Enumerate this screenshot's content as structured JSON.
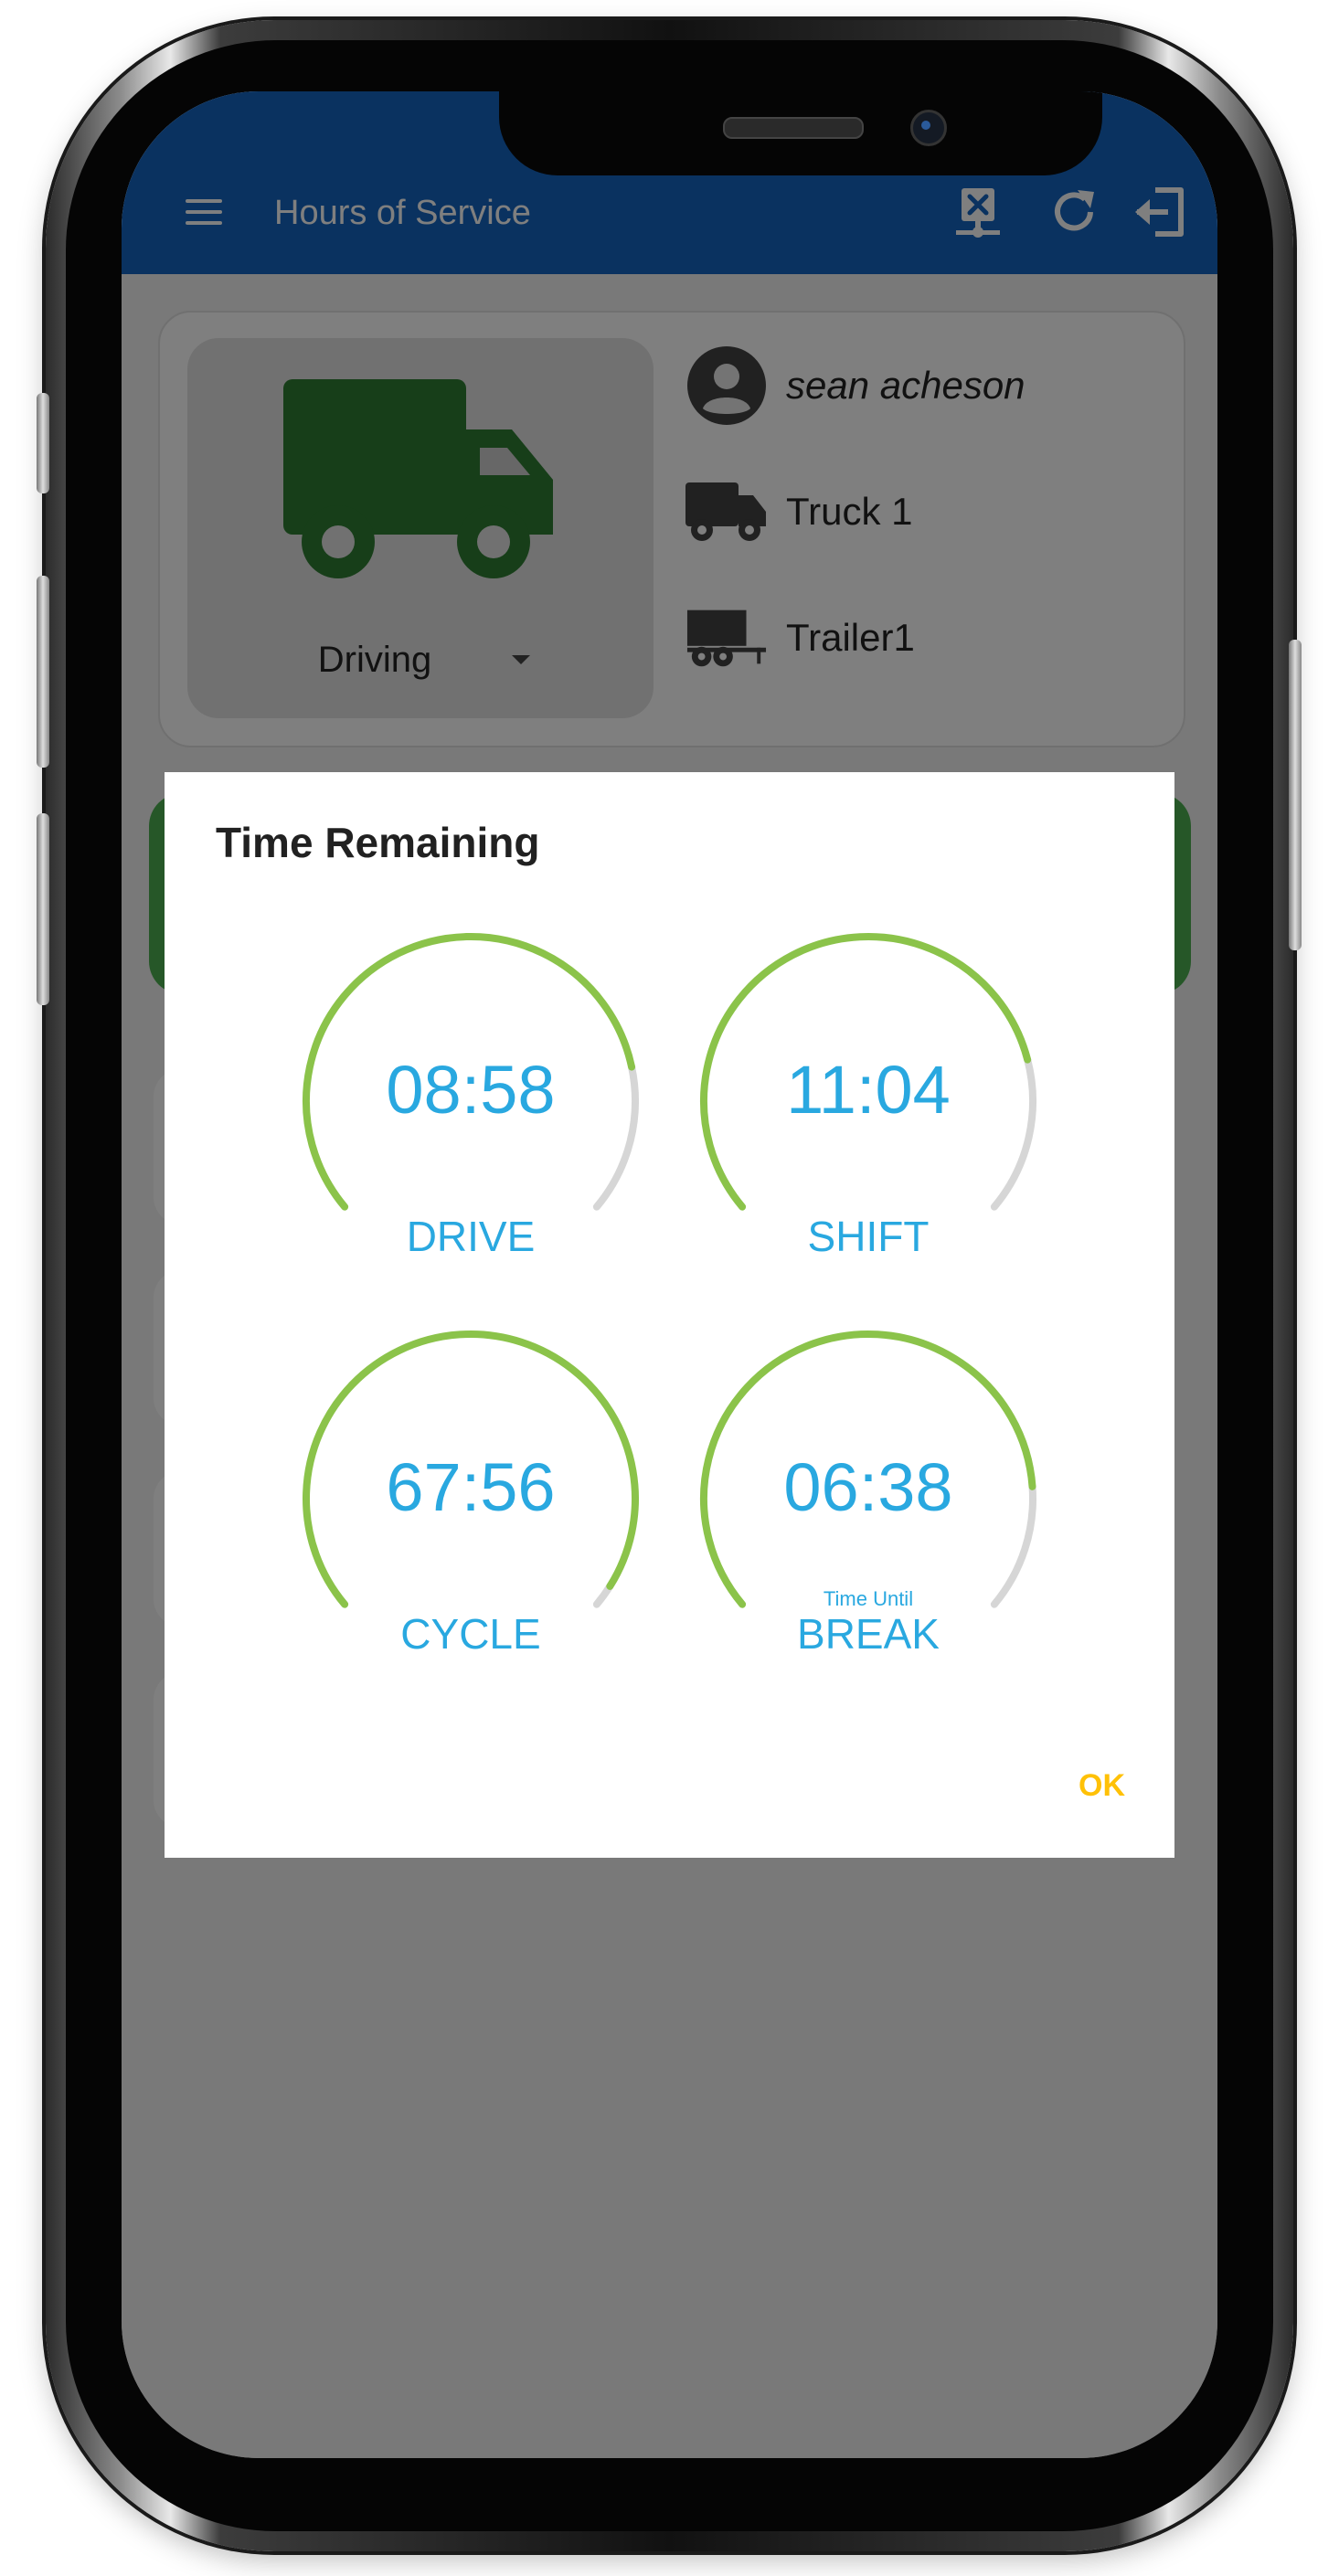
{
  "app": {
    "title": "Hours of Service"
  },
  "appbar_icons": [
    "menu-icon",
    "disconnect-icon",
    "refresh-icon",
    "logout-icon"
  ],
  "driver_card": {
    "status": "Driving",
    "driver_name": "sean acheson",
    "truck": "Truck 1",
    "trailer": "Trailer1"
  },
  "dialog": {
    "title": "Time Remaining",
    "ok_label": "OK",
    "gauges": [
      {
        "time": "08:58",
        "label": "DRIVE",
        "sublabel": "",
        "fraction": 0.8
      },
      {
        "time": "11:04",
        "label": "SHIFT",
        "sublabel": "",
        "fraction": 0.79
      },
      {
        "time": "67:56",
        "label": "CYCLE",
        "sublabel": "",
        "fraction": 0.97
      },
      {
        "time": "06:38",
        "label": "BREAK",
        "sublabel": "Time Until",
        "fraction": 0.83
      }
    ]
  },
  "colors": {
    "appbar": "#1565c0",
    "status_green": "#2e7d32",
    "gauge_green": "#8bc34a",
    "gauge_track": "#d6d6d6",
    "gauge_text": "#29a8e0",
    "ok_button": "#ffc107"
  }
}
